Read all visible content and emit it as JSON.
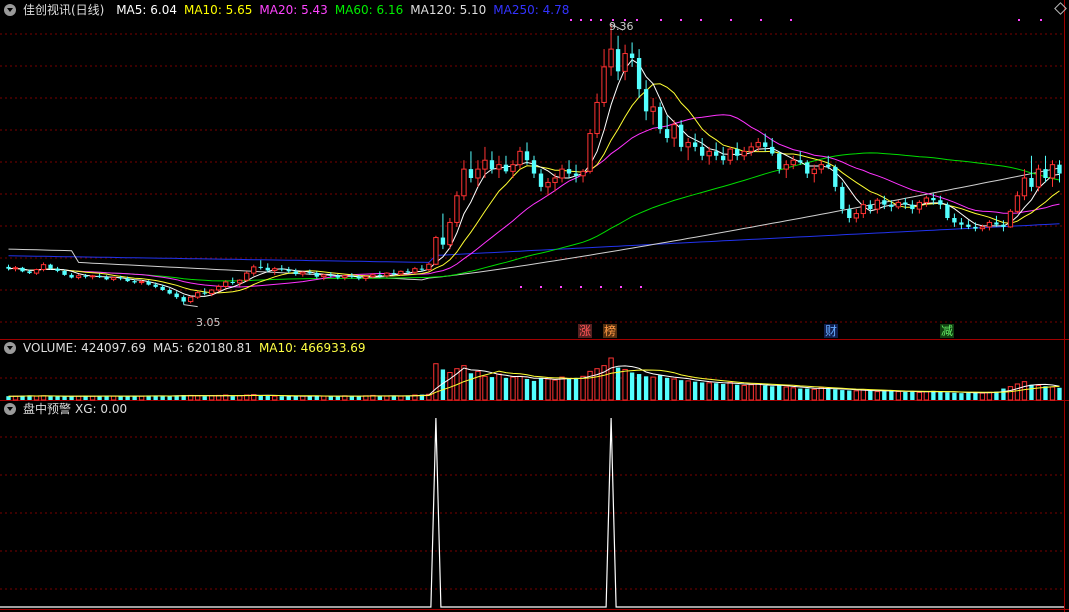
{
  "header": {
    "title": "佳创视讯(日线)",
    "ma": [
      {
        "label": "MA5: 6.04",
        "color": "#ffffff"
      },
      {
        "label": "MA10: 5.65",
        "color": "#ffff00"
      },
      {
        "label": "MA20: 5.43",
        "color": "#ff44ff"
      },
      {
        "label": "MA60: 6.16",
        "color": "#00ee00"
      },
      {
        "label": "MA120: 5.10",
        "color": "#dddddd"
      },
      {
        "label": "MA250: 4.78",
        "color": "#3333ff"
      }
    ]
  },
  "volume_header": {
    "label": "VOLUME: 424097.69",
    "ma5": "MA5: 620180.81",
    "ma10": "MA10: 466933.69"
  },
  "indicator_header": {
    "label": "盘中预警",
    "xg": "XG: 0.00"
  },
  "events": [
    {
      "text": "涨",
      "color": "#ff5555",
      "bg": "#552020"
    },
    {
      "text": "榜",
      "color": "#ff9944",
      "bg": "#553010"
    },
    {
      "text": "财",
      "color": "#66aaff",
      "bg": "#102050"
    },
    {
      "text": "减",
      "color": "#66ee66",
      "bg": "#104010"
    }
  ],
  "price_labels": {
    "high": "9.36",
    "low": "3.05"
  },
  "colors": {
    "up": "#ff3333",
    "down": "#54ffff",
    "grid": "#7a0000",
    "border": "#a00000"
  },
  "chart_data": {
    "type": "candlestick",
    "ylim": [
      2.3,
      9.5
    ],
    "high": 9.36,
    "low": 3.05,
    "xg_signal_index": [
      61,
      86
    ],
    "ohlc": [
      [
        3.9,
        3.95,
        3.82,
        3.86
      ],
      [
        3.86,
        3.92,
        3.8,
        3.88
      ],
      [
        3.88,
        3.9,
        3.78,
        3.8
      ],
      [
        3.8,
        3.84,
        3.74,
        3.76
      ],
      [
        3.76,
        3.86,
        3.72,
        3.84
      ],
      [
        3.84,
        4.0,
        3.8,
        3.95
      ],
      [
        3.95,
        3.97,
        3.84,
        3.86
      ],
      [
        3.86,
        3.9,
        3.78,
        3.81
      ],
      [
        3.81,
        3.84,
        3.7,
        3.72
      ],
      [
        3.72,
        3.76,
        3.64,
        3.66
      ],
      [
        3.66,
        3.74,
        3.62,
        3.7
      ],
      [
        3.7,
        3.74,
        3.64,
        3.68
      ],
      [
        3.68,
        3.72,
        3.62,
        3.7
      ],
      [
        3.7,
        3.75,
        3.65,
        3.67
      ],
      [
        3.67,
        3.71,
        3.6,
        3.62
      ],
      [
        3.62,
        3.68,
        3.58,
        3.66
      ],
      [
        3.66,
        3.7,
        3.6,
        3.64
      ],
      [
        3.64,
        3.68,
        3.56,
        3.58
      ],
      [
        3.58,
        3.62,
        3.52,
        3.55
      ],
      [
        3.55,
        3.6,
        3.5,
        3.57
      ],
      [
        3.57,
        3.6,
        3.48,
        3.5
      ],
      [
        3.5,
        3.55,
        3.42,
        3.45
      ],
      [
        3.45,
        3.5,
        3.36,
        3.38
      ],
      [
        3.38,
        3.42,
        3.28,
        3.3
      ],
      [
        3.3,
        3.35,
        3.18,
        3.22
      ],
      [
        3.22,
        3.26,
        3.05,
        3.12
      ],
      [
        3.12,
        3.25,
        3.08,
        3.22
      ],
      [
        3.22,
        3.36,
        3.18,
        3.32
      ],
      [
        3.32,
        3.42,
        3.26,
        3.3
      ],
      [
        3.3,
        3.4,
        3.24,
        3.38
      ],
      [
        3.38,
        3.5,
        3.34,
        3.46
      ],
      [
        3.46,
        3.6,
        3.42,
        3.56
      ],
      [
        3.56,
        3.66,
        3.5,
        3.54
      ],
      [
        3.54,
        3.62,
        3.46,
        3.6
      ],
      [
        3.6,
        3.8,
        3.56,
        3.76
      ],
      [
        3.76,
        3.95,
        3.7,
        3.9
      ],
      [
        3.9,
        4.05,
        3.84,
        3.88
      ],
      [
        3.88,
        3.98,
        3.78,
        3.82
      ],
      [
        3.82,
        3.9,
        3.72,
        3.86
      ],
      [
        3.86,
        3.94,
        3.8,
        3.84
      ],
      [
        3.84,
        3.9,
        3.76,
        3.8
      ],
      [
        3.8,
        3.86,
        3.7,
        3.74
      ],
      [
        3.74,
        3.8,
        3.68,
        3.78
      ],
      [
        3.78,
        3.84,
        3.72,
        3.76
      ],
      [
        3.76,
        3.8,
        3.64,
        3.68
      ],
      [
        3.68,
        3.74,
        3.6,
        3.72
      ],
      [
        3.72,
        3.78,
        3.66,
        3.7
      ],
      [
        3.7,
        3.74,
        3.62,
        3.66
      ],
      [
        3.66,
        3.72,
        3.6,
        3.7
      ],
      [
        3.7,
        3.76,
        3.64,
        3.68
      ],
      [
        3.68,
        3.72,
        3.6,
        3.64
      ],
      [
        3.64,
        3.7,
        3.58,
        3.68
      ],
      [
        3.68,
        3.76,
        3.64,
        3.72
      ],
      [
        3.72,
        3.8,
        3.66,
        3.7
      ],
      [
        3.7,
        3.78,
        3.66,
        3.76
      ],
      [
        3.76,
        3.84,
        3.7,
        3.74
      ],
      [
        3.74,
        3.82,
        3.7,
        3.8
      ],
      [
        3.8,
        3.86,
        3.74,
        3.78
      ],
      [
        3.78,
        3.9,
        3.74,
        3.86
      ],
      [
        3.86,
        3.94,
        3.8,
        3.84
      ],
      [
        3.84,
        4.0,
        3.8,
        3.96
      ],
      [
        3.96,
        4.6,
        3.94,
        4.56
      ],
      [
        4.56,
        5.1,
        4.3,
        4.4
      ],
      [
        4.4,
        5.0,
        4.3,
        4.9
      ],
      [
        4.9,
        5.6,
        4.8,
        5.5
      ],
      [
        5.5,
        6.3,
        5.4,
        6.1
      ],
      [
        6.1,
        6.5,
        5.8,
        5.9
      ],
      [
        5.9,
        6.3,
        5.7,
        6.1
      ],
      [
        6.1,
        6.6,
        5.9,
        6.3
      ],
      [
        6.3,
        6.5,
        6.0,
        6.1
      ],
      [
        6.1,
        6.4,
        5.9,
        6.2
      ],
      [
        6.2,
        6.4,
        6.0,
        6.05
      ],
      [
        6.05,
        6.3,
        5.9,
        6.2
      ],
      [
        6.2,
        6.6,
        6.1,
        6.5
      ],
      [
        6.5,
        6.7,
        6.2,
        6.3
      ],
      [
        6.3,
        6.4,
        5.9,
        6.0
      ],
      [
        6.0,
        6.1,
        5.6,
        5.7
      ],
      [
        5.7,
        5.9,
        5.5,
        5.8
      ],
      [
        5.8,
        6.0,
        5.6,
        5.9
      ],
      [
        5.9,
        6.2,
        5.8,
        6.1
      ],
      [
        6.1,
        6.3,
        5.9,
        6.0
      ],
      [
        6.0,
        6.2,
        5.8,
        5.95
      ],
      [
        5.95,
        6.1,
        5.8,
        6.05
      ],
      [
        6.05,
        7.0,
        6.0,
        6.9
      ],
      [
        6.9,
        7.8,
        6.8,
        7.6
      ],
      [
        7.6,
        8.8,
        7.5,
        8.4
      ],
      [
        8.4,
        9.36,
        8.2,
        8.8
      ],
      [
        8.8,
        9.1,
        8.1,
        8.3
      ],
      [
        8.3,
        8.9,
        8.1,
        8.7
      ],
      [
        8.7,
        8.95,
        8.4,
        8.6
      ],
      [
        8.6,
        8.8,
        7.7,
        7.9
      ],
      [
        7.9,
        8.1,
        7.2,
        7.4
      ],
      [
        7.4,
        7.7,
        7.1,
        7.5
      ],
      [
        7.5,
        7.6,
        6.9,
        7.0
      ],
      [
        7.0,
        7.3,
        6.7,
        6.8
      ],
      [
        6.8,
        7.2,
        6.6,
        7.1
      ],
      [
        7.1,
        7.2,
        6.5,
        6.6
      ],
      [
        6.6,
        6.8,
        6.3,
        6.7
      ],
      [
        6.7,
        6.9,
        6.5,
        6.6
      ],
      [
        6.6,
        6.8,
        6.3,
        6.4
      ],
      [
        6.4,
        6.6,
        6.2,
        6.5
      ],
      [
        6.5,
        6.7,
        6.3,
        6.4
      ],
      [
        6.4,
        6.6,
        6.2,
        6.3
      ],
      [
        6.3,
        6.6,
        6.2,
        6.55
      ],
      [
        6.55,
        6.7,
        6.3,
        6.4
      ],
      [
        6.4,
        6.6,
        6.3,
        6.5
      ],
      [
        6.5,
        6.7,
        6.4,
        6.6
      ],
      [
        6.6,
        6.8,
        6.5,
        6.7
      ],
      [
        6.7,
        6.9,
        6.5,
        6.6
      ],
      [
        6.6,
        6.8,
        6.4,
        6.45
      ],
      [
        6.45,
        6.5,
        6.0,
        6.1
      ],
      [
        6.1,
        6.3,
        5.9,
        6.2
      ],
      [
        6.2,
        6.4,
        6.1,
        6.3
      ],
      [
        6.3,
        6.5,
        6.2,
        6.25
      ],
      [
        6.25,
        6.3,
        5.9,
        6.0
      ],
      [
        6.0,
        6.2,
        5.8,
        6.1
      ],
      [
        6.1,
        6.3,
        6.0,
        6.2
      ],
      [
        6.2,
        6.4,
        6.1,
        6.15
      ],
      [
        6.15,
        6.2,
        5.6,
        5.7
      ],
      [
        5.7,
        5.8,
        5.1,
        5.2
      ],
      [
        5.2,
        5.3,
        4.9,
        5.0
      ],
      [
        5.0,
        5.2,
        4.9,
        5.1
      ],
      [
        5.1,
        5.4,
        5.0,
        5.3
      ],
      [
        5.3,
        5.4,
        5.1,
        5.2
      ],
      [
        5.2,
        5.45,
        5.1,
        5.4
      ],
      [
        5.4,
        5.5,
        5.2,
        5.3
      ],
      [
        5.3,
        5.4,
        5.15,
        5.25
      ],
      [
        5.25,
        5.4,
        5.2,
        5.35
      ],
      [
        5.35,
        5.45,
        5.2,
        5.3
      ],
      [
        5.3,
        5.4,
        5.1,
        5.2
      ],
      [
        5.2,
        5.4,
        5.1,
        5.35
      ],
      [
        5.35,
        5.5,
        5.25,
        5.45
      ],
      [
        5.45,
        5.55,
        5.3,
        5.4
      ],
      [
        5.4,
        5.5,
        5.2,
        5.3
      ],
      [
        5.3,
        5.35,
        4.95,
        5.0
      ],
      [
        5.0,
        5.1,
        4.8,
        4.9
      ],
      [
        4.9,
        5.0,
        4.75,
        4.85
      ],
      [
        4.85,
        4.95,
        4.75,
        4.8
      ],
      [
        4.8,
        4.9,
        4.7,
        4.76
      ],
      [
        4.76,
        4.85,
        4.7,
        4.8
      ],
      [
        4.8,
        4.95,
        4.72,
        4.9
      ],
      [
        4.9,
        5.05,
        4.8,
        4.85
      ],
      [
        4.85,
        4.95,
        4.7,
        4.8
      ],
      [
        4.8,
        5.2,
        4.78,
        5.15
      ],
      [
        5.15,
        5.6,
        5.1,
        5.5
      ],
      [
        5.5,
        6.1,
        5.4,
        5.9
      ],
      [
        5.9,
        6.4,
        5.6,
        5.7
      ],
      [
        5.7,
        6.2,
        5.6,
        6.1
      ],
      [
        6.1,
        6.4,
        5.8,
        5.9
      ],
      [
        5.9,
        6.3,
        5.7,
        6.2
      ],
      [
        6.2,
        6.3,
        5.8,
        6.0
      ]
    ],
    "volume": [
      0.1,
      0.1,
      0.11,
      0.12,
      0.1,
      0.11,
      0.1,
      0.1,
      0.09,
      0.1,
      0.1,
      0.11,
      0.1,
      0.1,
      0.11,
      0.1,
      0.1,
      0.1,
      0.11,
      0.1,
      0.12,
      0.11,
      0.1,
      0.1,
      0.12,
      0.13,
      0.12,
      0.11,
      0.1,
      0.11,
      0.12,
      0.13,
      0.1,
      0.11,
      0.13,
      0.14,
      0.12,
      0.11,
      0.1,
      0.1,
      0.1,
      0.11,
      0.1,
      0.1,
      0.11,
      0.1,
      0.1,
      0.1,
      0.11,
      0.1,
      0.1,
      0.11,
      0.12,
      0.11,
      0.1,
      0.11,
      0.1,
      0.12,
      0.13,
      0.14,
      0.15,
      0.95,
      0.8,
      0.72,
      0.82,
      0.9,
      0.7,
      0.75,
      0.62,
      0.6,
      0.68,
      0.58,
      0.6,
      0.62,
      0.55,
      0.5,
      0.58,
      0.55,
      0.52,
      0.6,
      0.55,
      0.58,
      0.62,
      0.75,
      0.82,
      0.9,
      1.1,
      0.85,
      0.8,
      0.72,
      0.68,
      0.62,
      0.6,
      0.65,
      0.58,
      0.55,
      0.52,
      0.5,
      0.48,
      0.46,
      0.45,
      0.44,
      0.42,
      0.46,
      0.4,
      0.38,
      0.4,
      0.42,
      0.38,
      0.36,
      0.38,
      0.34,
      0.32,
      0.3,
      0.3,
      0.28,
      0.32,
      0.3,
      0.28,
      0.26,
      0.25,
      0.24,
      0.26,
      0.24,
      0.22,
      0.23,
      0.24,
      0.22,
      0.21,
      0.22,
      0.2,
      0.22,
      0.24,
      0.22,
      0.2,
      0.19,
      0.18,
      0.19,
      0.2,
      0.18,
      0.2,
      0.22,
      0.3,
      0.35,
      0.42,
      0.48,
      0.4,
      0.38,
      0.36,
      0.34,
      0.32
    ]
  }
}
